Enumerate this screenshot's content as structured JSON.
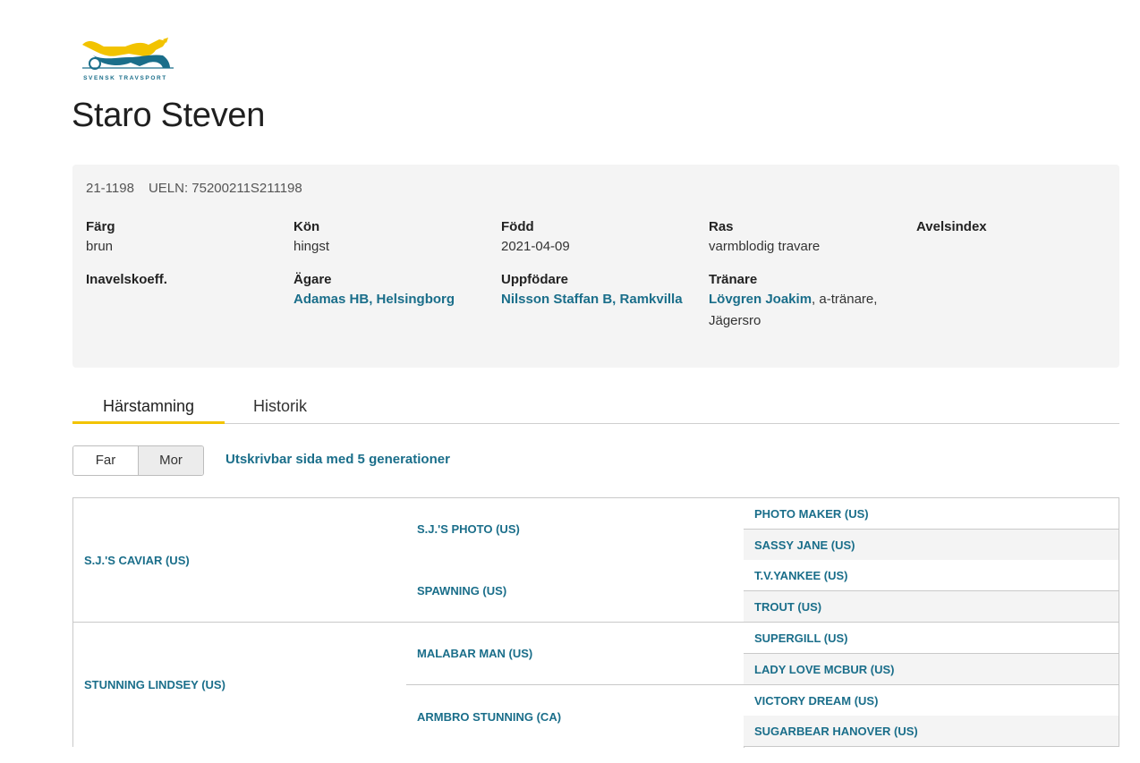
{
  "logo": {
    "text": "SVENSK TRAVSPORT"
  },
  "horse": {
    "name": "Staro Steven",
    "reg_no": "21-1198",
    "ueln": "UELN: 75200211S211198"
  },
  "info": {
    "farg": {
      "label": "Färg",
      "value": "brun"
    },
    "kon": {
      "label": "Kön",
      "value": "hingst"
    },
    "fodd": {
      "label": "Född",
      "value": "2021-04-09"
    },
    "ras": {
      "label": "Ras",
      "value": "varmblodig travare"
    },
    "avelsindex": {
      "label": "Avelsindex"
    },
    "inavel": {
      "label": "Inavelskoeff."
    },
    "agare": {
      "label": "Ägare",
      "value": "Adamas HB, Helsingborg"
    },
    "uppfodare": {
      "label": "Uppfödare",
      "value": "Nilsson Staffan B, Ramkvilla"
    },
    "tranare": {
      "label": "Tränare",
      "name": "Lövgren Joakim",
      "rest1": ", a-tränare,",
      "rest2": "Jägersro"
    }
  },
  "tabs": [
    {
      "label": "Härstamning"
    },
    {
      "label": "Historik"
    }
  ],
  "segment": {
    "far": "Far",
    "mor": "Mor"
  },
  "print_link": "Utskrivbar sida med 5 generationer",
  "pedigree": {
    "g1": [
      "S.J.'S CAVIAR (US)",
      "STUNNING LINDSEY (US)"
    ],
    "g2": [
      "S.J.'S PHOTO (US)",
      "SPAWNING (US)",
      "MALABAR MAN (US)",
      "ARMBRO STUNNING (CA)"
    ],
    "g3": [
      "PHOTO MAKER (US)",
      "SASSY JANE (US)",
      "T.V.YANKEE (US)",
      "TROUT (US)",
      "SUPERGILL (US)",
      "LADY LOVE MCBUR (US)",
      "VICTORY DREAM (US)",
      "SUGARBEAR HANOVER (US)"
    ]
  },
  "colors": {
    "link": "#1a6e8a",
    "tab_accent": "#f2c300",
    "logo_yellow": "#f2c300",
    "logo_blue": "#1a6e8a"
  }
}
